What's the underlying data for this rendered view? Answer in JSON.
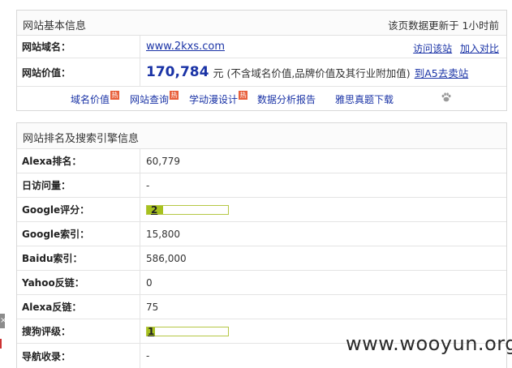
{
  "basic": {
    "title": "网站基本信息",
    "update_note": "该页数据更新于 1小时前",
    "domain_label": "网站域名：",
    "domain_value": "www.2kxs.com",
    "visit_link": "访问该站",
    "compare_link": "加入对比",
    "price_label": "网站价值：",
    "price_value": "170,784",
    "price_unit": "元",
    "price_note": "(不含域名价值,品牌价值及其行业附加值)",
    "sell_link": "到A5去卖站",
    "links": [
      {
        "label": "域名价值",
        "hot": true
      },
      {
        "label": "网站查询",
        "hot": true
      },
      {
        "label": "学动漫设计",
        "hot": true
      },
      {
        "label": "数据分析报告",
        "hot": false
      },
      {
        "label": "雅思真题下载",
        "hot": false
      }
    ],
    "hot_text": "热"
  },
  "ranking": {
    "title": "网站排名及搜索引擎信息",
    "rows": [
      {
        "label": "Alexa排名：",
        "value": "60,779"
      },
      {
        "label": "日访问量：",
        "value": "-"
      },
      {
        "label": "Google评分：",
        "value": "2",
        "fill_fraction": 0.2
      },
      {
        "label": "Google索引：",
        "value": "15,800"
      },
      {
        "label": "Baidu索引：",
        "value": "586,000"
      },
      {
        "label": "Yahoo反链：",
        "value": "0"
      },
      {
        "label": "Alexa反链：",
        "value": "75"
      },
      {
        "label": "搜狗评级：",
        "value": "1",
        "fill_fraction": 0.1
      },
      {
        "label": "导航收录：",
        "value": "-"
      }
    ]
  },
  "watermark": "www.wooyun.org",
  "side_close": "×",
  "colors": {
    "link": "#1a33a6",
    "bar_fill": "#a7c11f",
    "hot": "#e8603c"
  }
}
